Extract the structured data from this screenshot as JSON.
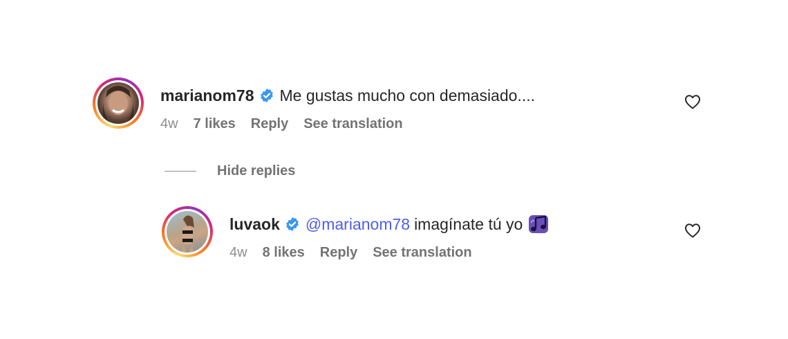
{
  "comments": [
    {
      "username": "marianom78",
      "verified": true,
      "text": "Me gustas mucho con demasiado....",
      "time": "4w",
      "likes": "7 likes",
      "reply_label": "Reply",
      "translate_label": "See translation"
    }
  ],
  "hide_replies_label": "Hide replies",
  "replies": [
    {
      "username": "luvaok",
      "verified": true,
      "mention": "@marianom78",
      "text": "imagínate tú yo",
      "emoji": "music-notes-emoji",
      "time": "4w",
      "likes": "8 likes",
      "reply_label": "Reply",
      "translate_label": "See translation"
    }
  ],
  "colors": {
    "mention": "#4c5ef0",
    "verified": "#3897f0",
    "meta_text": "#8e8e8e",
    "emoji_purple": "#5b3fa0"
  }
}
